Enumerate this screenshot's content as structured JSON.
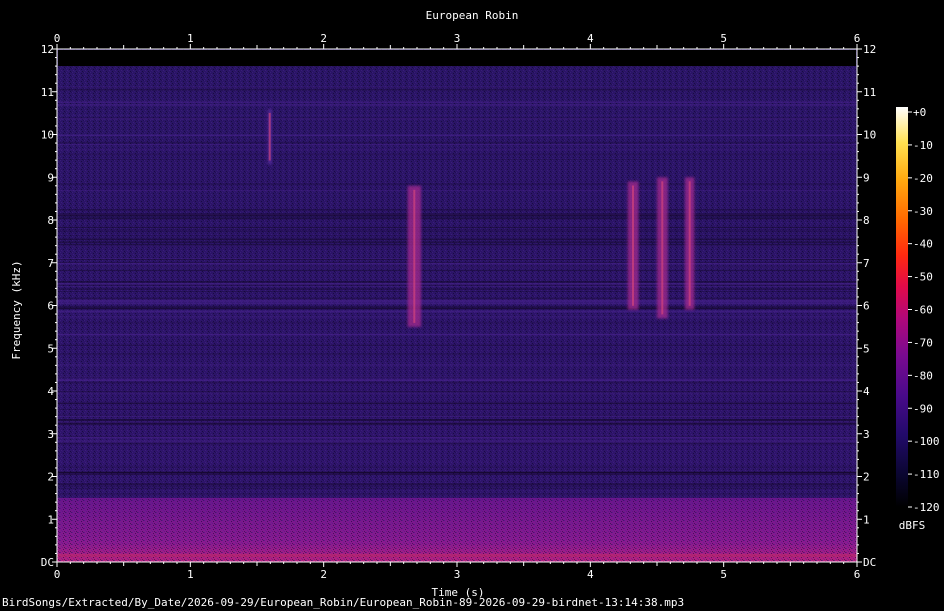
{
  "chart_data": {
    "type": "heatmap",
    "title": "European Robin",
    "xlabel": "Time (s)",
    "ylabel": "Frequency (kHz)",
    "x_ticks": [
      "0",
      "1",
      "2",
      "3",
      "4",
      "5",
      "6"
    ],
    "y_ticks": [
      "DC",
      "1",
      "2",
      "3",
      "4",
      "5",
      "6",
      "7",
      "8",
      "9",
      "10",
      "11",
      "12"
    ],
    "xlim": [
      0,
      6
    ],
    "ylim": [
      0,
      12
    ],
    "colorbar": {
      "label": "dBFS",
      "ticks": [
        "+0",
        "-10",
        "-20",
        "-30",
        "-40",
        "-50",
        "-60",
        "-70",
        "-80",
        "-90",
        "-100",
        "-110",
        "-120"
      ],
      "range": [
        -120,
        0
      ]
    },
    "noise_floor_cutoff_khz": 11.6,
    "background_level_dbfs": -95,
    "low_band": {
      "freq_range_khz": [
        0,
        1.5
      ],
      "level_dbfs": -75
    },
    "calls": [
      {
        "t_start": 2.63,
        "t_end": 2.73,
        "f_low_khz": 5.5,
        "f_high_khz": 8.8,
        "level_dbfs": -65
      },
      {
        "t_start": 1.58,
        "t_end": 1.61,
        "f_low_khz": 9.3,
        "f_high_khz": 10.6,
        "level_dbfs": -85
      },
      {
        "t_start": 4.28,
        "t_end": 4.36,
        "f_low_khz": 5.9,
        "f_high_khz": 8.9,
        "level_dbfs": -65
      },
      {
        "t_start": 4.5,
        "t_end": 4.58,
        "f_low_khz": 5.7,
        "f_high_khz": 9.0,
        "level_dbfs": -65
      },
      {
        "t_start": 4.71,
        "t_end": 4.78,
        "f_low_khz": 5.9,
        "f_high_khz": 9.0,
        "level_dbfs": -65
      }
    ]
  },
  "footer": {
    "file_path": "BirdSongs/Extracted/By_Date/2026-09-29/European_Robin/European_Robin-89-2026-09-29-birdnet-13:14:38.mp3"
  }
}
